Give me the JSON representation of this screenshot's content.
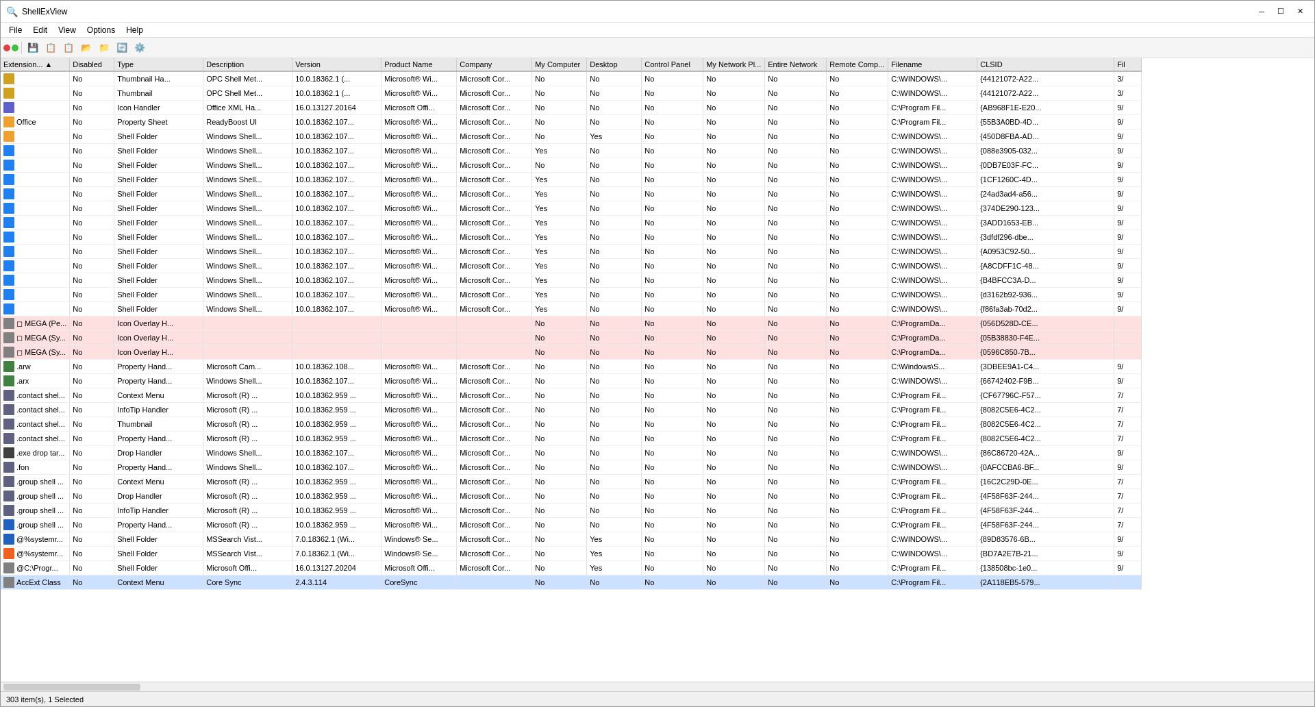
{
  "window": {
    "title": "ShellExView",
    "icon": "🔍"
  },
  "menus": [
    "File",
    "Edit",
    "View",
    "Options",
    "Help"
  ],
  "toolbar": {
    "dots": [
      "red-dot",
      "green-dot"
    ],
    "buttons": [
      "💾",
      "📋",
      "📋",
      "📂",
      "📁",
      "🔄",
      "⚙️"
    ]
  },
  "columns": [
    {
      "id": "ext",
      "label": "Extension...",
      "sort": true
    },
    {
      "id": "disabled",
      "label": "Disabled"
    },
    {
      "id": "type",
      "label": "Type"
    },
    {
      "id": "desc",
      "label": "Description"
    },
    {
      "id": "ver",
      "label": "Version"
    },
    {
      "id": "prod",
      "label": "Product Name"
    },
    {
      "id": "comp",
      "label": "Company"
    },
    {
      "id": "mycomp",
      "label": "My Computer"
    },
    {
      "id": "desktop",
      "label": "Desktop"
    },
    {
      "id": "cp",
      "label": "Control Panel"
    },
    {
      "id": "mynet",
      "label": "My Network Pl..."
    },
    {
      "id": "entnet",
      "label": "Entire Network"
    },
    {
      "id": "remcomp",
      "label": "Remote Comp..."
    },
    {
      "id": "filename",
      "label": "Filename"
    },
    {
      "id": "clsid",
      "label": "CLSID"
    },
    {
      "id": "fil",
      "label": "Fil"
    }
  ],
  "rows": [
    {
      "ext": "",
      "disabled": "No",
      "type": "Thumbnail Ha...",
      "desc": "OPC Shell Met...",
      "ver": "10.0.18362.1 (...",
      "prod": "Microsoft® Wi...",
      "comp": "Microsoft Cor...",
      "mycomp": "No",
      "desktop": "No",
      "cp": "No",
      "mynet": "No",
      "entnet": "No",
      "remcomp": "No",
      "filename": "C:\\WINDOWS\\...",
      "clsid": "{44121072-A22...",
      "fil": "3/",
      "highlight": ""
    },
    {
      "ext": "",
      "disabled": "No",
      "type": "Thumbnail",
      "desc": "OPC Shell Met...",
      "ver": "10.0.18362.1 (...",
      "prod": "Microsoft® Wi...",
      "comp": "Microsoft Cor...",
      "mycomp": "No",
      "desktop": "No",
      "cp": "No",
      "mynet": "No",
      "entnet": "No",
      "remcomp": "No",
      "filename": "C:\\WINDOWS\\...",
      "clsid": "{44121072-A22...",
      "fil": "3/",
      "highlight": ""
    },
    {
      "ext": "",
      "disabled": "No",
      "type": "Icon Handler",
      "desc": "Office XML Ha...",
      "ver": "16.0.13127.20164",
      "prod": "Microsoft Offi...",
      "comp": "Microsoft Cor...",
      "mycomp": "No",
      "desktop": "No",
      "cp": "No",
      "mynet": "No",
      "entnet": "No",
      "remcomp": "No",
      "filename": "C:\\Program Fil...",
      "clsid": "{AB968F1E-E20...",
      "fil": "9/",
      "highlight": ""
    },
    {
      "ext": "Office",
      "disabled": "No",
      "type": "Property Sheet",
      "desc": "ReadyBoost UI",
      "ver": "10.0.18362.107...",
      "prod": "Microsoft® Wi...",
      "comp": "Microsoft Cor...",
      "mycomp": "No",
      "desktop": "No",
      "cp": "No",
      "mynet": "No",
      "entnet": "No",
      "remcomp": "No",
      "filename": "C:\\Program Fil...",
      "clsid": "{55B3A0BD-4D...",
      "fil": "9/",
      "highlight": ""
    },
    {
      "ext": "",
      "disabled": "No",
      "type": "Shell Folder",
      "desc": "Windows Shell...",
      "ver": "10.0.18362.107...",
      "prod": "Microsoft® Wi...",
      "comp": "Microsoft Cor...",
      "mycomp": "No",
      "desktop": "Yes",
      "cp": "No",
      "mynet": "No",
      "entnet": "No",
      "remcomp": "No",
      "filename": "C:\\WINDOWS\\...",
      "clsid": "{450D8FBA-AD...",
      "fil": "9/",
      "highlight": ""
    },
    {
      "ext": "",
      "disabled": "No",
      "type": "Shell Folder",
      "desc": "Windows Shell...",
      "ver": "10.0.18362.107...",
      "prod": "Microsoft® Wi...",
      "comp": "Microsoft Cor...",
      "mycomp": "Yes",
      "desktop": "No",
      "cp": "No",
      "mynet": "No",
      "entnet": "No",
      "remcomp": "No",
      "filename": "C:\\WINDOWS\\...",
      "clsid": "{088e3905-032...",
      "fil": "9/",
      "highlight": ""
    },
    {
      "ext": "",
      "disabled": "No",
      "type": "Shell Folder",
      "desc": "Windows Shell...",
      "ver": "10.0.18362.107...",
      "prod": "Microsoft® Wi...",
      "comp": "Microsoft Cor...",
      "mycomp": "No",
      "desktop": "No",
      "cp": "No",
      "mynet": "No",
      "entnet": "No",
      "remcomp": "No",
      "filename": "C:\\WINDOWS\\...",
      "clsid": "{0DB7E03F-FC...",
      "fil": "9/",
      "highlight": ""
    },
    {
      "ext": "",
      "disabled": "No",
      "type": "Shell Folder",
      "desc": "Windows Shell...",
      "ver": "10.0.18362.107...",
      "prod": "Microsoft® Wi...",
      "comp": "Microsoft Cor...",
      "mycomp": "Yes",
      "desktop": "No",
      "cp": "No",
      "mynet": "No",
      "entnet": "No",
      "remcomp": "No",
      "filename": "C:\\WINDOWS\\...",
      "clsid": "{1CF1260C-4D...",
      "fil": "9/",
      "highlight": ""
    },
    {
      "ext": "",
      "disabled": "No",
      "type": "Shell Folder",
      "desc": "Windows Shell...",
      "ver": "10.0.18362.107...",
      "prod": "Microsoft® Wi...",
      "comp": "Microsoft Cor...",
      "mycomp": "Yes",
      "desktop": "No",
      "cp": "No",
      "mynet": "No",
      "entnet": "No",
      "remcomp": "No",
      "filename": "C:\\WINDOWS\\...",
      "clsid": "{24ad3ad4-a56...",
      "fil": "9/",
      "highlight": ""
    },
    {
      "ext": "",
      "disabled": "No",
      "type": "Shell Folder",
      "desc": "Windows Shell...",
      "ver": "10.0.18362.107...",
      "prod": "Microsoft® Wi...",
      "comp": "Microsoft Cor...",
      "mycomp": "Yes",
      "desktop": "No",
      "cp": "No",
      "mynet": "No",
      "entnet": "No",
      "remcomp": "No",
      "filename": "C:\\WINDOWS\\...",
      "clsid": "{374DE290-123...",
      "fil": "9/",
      "highlight": ""
    },
    {
      "ext": "",
      "disabled": "No",
      "type": "Shell Folder",
      "desc": "Windows Shell...",
      "ver": "10.0.18362.107...",
      "prod": "Microsoft® Wi...",
      "comp": "Microsoft Cor...",
      "mycomp": "Yes",
      "desktop": "No",
      "cp": "No",
      "mynet": "No",
      "entnet": "No",
      "remcomp": "No",
      "filename": "C:\\WINDOWS\\...",
      "clsid": "{3ADD1653-EB...",
      "fil": "9/",
      "highlight": ""
    },
    {
      "ext": "",
      "disabled": "No",
      "type": "Shell Folder",
      "desc": "Windows Shell...",
      "ver": "10.0.18362.107...",
      "prod": "Microsoft® Wi...",
      "comp": "Microsoft Cor...",
      "mycomp": "Yes",
      "desktop": "No",
      "cp": "No",
      "mynet": "No",
      "entnet": "No",
      "remcomp": "No",
      "filename": "C:\\WINDOWS\\...",
      "clsid": "{3dfdf296-dbe...",
      "fil": "9/",
      "highlight": ""
    },
    {
      "ext": "",
      "disabled": "No",
      "type": "Shell Folder",
      "desc": "Windows Shell...",
      "ver": "10.0.18362.107...",
      "prod": "Microsoft® Wi...",
      "comp": "Microsoft Cor...",
      "mycomp": "Yes",
      "desktop": "No",
      "cp": "No",
      "mynet": "No",
      "entnet": "No",
      "remcomp": "No",
      "filename": "C:\\WINDOWS\\...",
      "clsid": "{A0953C92-50...",
      "fil": "9/",
      "highlight": ""
    },
    {
      "ext": "",
      "disabled": "No",
      "type": "Shell Folder",
      "desc": "Windows Shell...",
      "ver": "10.0.18362.107...",
      "prod": "Microsoft® Wi...",
      "comp": "Microsoft Cor...",
      "mycomp": "Yes",
      "desktop": "No",
      "cp": "No",
      "mynet": "No",
      "entnet": "No",
      "remcomp": "No",
      "filename": "C:\\WINDOWS\\...",
      "clsid": "{A8CDFF1C-48...",
      "fil": "9/",
      "highlight": ""
    },
    {
      "ext": "",
      "disabled": "No",
      "type": "Shell Folder",
      "desc": "Windows Shell...",
      "ver": "10.0.18362.107...",
      "prod": "Microsoft® Wi...",
      "comp": "Microsoft Cor...",
      "mycomp": "Yes",
      "desktop": "No",
      "cp": "No",
      "mynet": "No",
      "entnet": "No",
      "remcomp": "No",
      "filename": "C:\\WINDOWS\\...",
      "clsid": "{B4BFCC3A-D...",
      "fil": "9/",
      "highlight": ""
    },
    {
      "ext": "",
      "disabled": "No",
      "type": "Shell Folder",
      "desc": "Windows Shell...",
      "ver": "10.0.18362.107...",
      "prod": "Microsoft® Wi...",
      "comp": "Microsoft Cor...",
      "mycomp": "Yes",
      "desktop": "No",
      "cp": "No",
      "mynet": "No",
      "entnet": "No",
      "remcomp": "No",
      "filename": "C:\\WINDOWS\\...",
      "clsid": "{d3162b92-936...",
      "fil": "9/",
      "highlight": ""
    },
    {
      "ext": "",
      "disabled": "No",
      "type": "Shell Folder",
      "desc": "Windows Shell...",
      "ver": "10.0.18362.107...",
      "prod": "Microsoft® Wi...",
      "comp": "Microsoft Cor...",
      "mycomp": "Yes",
      "desktop": "No",
      "cp": "No",
      "mynet": "No",
      "entnet": "No",
      "remcomp": "No",
      "filename": "C:\\WINDOWS\\...",
      "clsid": "{f86fa3ab-70d2...",
      "fil": "9/",
      "highlight": ""
    },
    {
      "ext": "◻ MEGA (Pe...",
      "disabled": "No",
      "type": "Icon Overlay H...",
      "desc": "",
      "ver": "",
      "prod": "",
      "comp": "",
      "mycomp": "No",
      "desktop": "No",
      "cp": "No",
      "mynet": "No",
      "entnet": "No",
      "remcomp": "No",
      "filename": "C:\\ProgramDa...",
      "clsid": "{056D528D-CE...",
      "fil": "",
      "highlight": "red"
    },
    {
      "ext": "◻ MEGA (Sy...",
      "disabled": "No",
      "type": "Icon Overlay H...",
      "desc": "",
      "ver": "",
      "prod": "",
      "comp": "",
      "mycomp": "No",
      "desktop": "No",
      "cp": "No",
      "mynet": "No",
      "entnet": "No",
      "remcomp": "No",
      "filename": "C:\\ProgramDa...",
      "clsid": "{05B38830-F4E...",
      "fil": "",
      "highlight": "red"
    },
    {
      "ext": "◻ MEGA (Sy...",
      "disabled": "No",
      "type": "Icon Overlay H...",
      "desc": "",
      "ver": "",
      "prod": "",
      "comp": "",
      "mycomp": "No",
      "desktop": "No",
      "cp": "No",
      "mynet": "No",
      "entnet": "No",
      "remcomp": "No",
      "filename": "C:\\ProgramDa...",
      "clsid": "{0596C850-7B...",
      "fil": "",
      "highlight": "red"
    },
    {
      "ext": ".arw",
      "disabled": "No",
      "type": "Property Hand...",
      "desc": "Microsoft Cam...",
      "ver": "10.0.18362.108...",
      "prod": "Microsoft® Wi...",
      "comp": "Microsoft Cor...",
      "mycomp": "No",
      "desktop": "No",
      "cp": "No",
      "mynet": "No",
      "entnet": "No",
      "remcomp": "No",
      "filename": "C:\\Windows\\S...",
      "clsid": "{3DBEE9A1-C4...",
      "fil": "9/",
      "highlight": ""
    },
    {
      "ext": ".arx",
      "disabled": "No",
      "type": "Property Hand...",
      "desc": "Windows Shell...",
      "ver": "10.0.18362.107...",
      "prod": "Microsoft® Wi...",
      "comp": "Microsoft Cor...",
      "mycomp": "No",
      "desktop": "No",
      "cp": "No",
      "mynet": "No",
      "entnet": "No",
      "remcomp": "No",
      "filename": "C:\\WINDOWS\\...",
      "clsid": "{66742402-F9B...",
      "fil": "9/",
      "highlight": ""
    },
    {
      "ext": ".contact shel...",
      "disabled": "No",
      "type": "Context Menu",
      "desc": "Microsoft (R) ...",
      "ver": "10.0.18362.959 ...",
      "prod": "Microsoft® Wi...",
      "comp": "Microsoft Cor...",
      "mycomp": "No",
      "desktop": "No",
      "cp": "No",
      "mynet": "No",
      "entnet": "No",
      "remcomp": "No",
      "filename": "C:\\Program Fil...",
      "clsid": "{CF67796C-F57...",
      "fil": "7/",
      "highlight": ""
    },
    {
      "ext": ".contact shel...",
      "disabled": "No",
      "type": "InfoTip Handler",
      "desc": "Microsoft (R) ...",
      "ver": "10.0.18362.959 ...",
      "prod": "Microsoft® Wi...",
      "comp": "Microsoft Cor...",
      "mycomp": "No",
      "desktop": "No",
      "cp": "No",
      "mynet": "No",
      "entnet": "No",
      "remcomp": "No",
      "filename": "C:\\Program Fil...",
      "clsid": "{8082C5E6-4C2...",
      "fil": "7/",
      "highlight": ""
    },
    {
      "ext": ".contact shel...",
      "disabled": "No",
      "type": "Thumbnail",
      "desc": "Microsoft (R) ...",
      "ver": "10.0.18362.959 ...",
      "prod": "Microsoft® Wi...",
      "comp": "Microsoft Cor...",
      "mycomp": "No",
      "desktop": "No",
      "cp": "No",
      "mynet": "No",
      "entnet": "No",
      "remcomp": "No",
      "filename": "C:\\Program Fil...",
      "clsid": "{8082C5E6-4C2...",
      "fil": "7/",
      "highlight": ""
    },
    {
      "ext": ".contact shel...",
      "disabled": "No",
      "type": "Property Hand...",
      "desc": "Microsoft (R) ...",
      "ver": "10.0.18362.959 ...",
      "prod": "Microsoft® Wi...",
      "comp": "Microsoft Cor...",
      "mycomp": "No",
      "desktop": "No",
      "cp": "No",
      "mynet": "No",
      "entnet": "No",
      "remcomp": "No",
      "filename": "C:\\Program Fil...",
      "clsid": "{8082C5E6-4C2...",
      "fil": "7/",
      "highlight": ""
    },
    {
      "ext": ".exe drop tar...",
      "disabled": "No",
      "type": "Drop Handler",
      "desc": "Windows Shell...",
      "ver": "10.0.18362.107...",
      "prod": "Microsoft® Wi...",
      "comp": "Microsoft Cor...",
      "mycomp": "No",
      "desktop": "No",
      "cp": "No",
      "mynet": "No",
      "entnet": "No",
      "remcomp": "No",
      "filename": "C:\\WINDOWS\\...",
      "clsid": "{86C86720-42A...",
      "fil": "9/",
      "highlight": ""
    },
    {
      "ext": ".fon",
      "disabled": "No",
      "type": "Property Hand...",
      "desc": "Windows Shell...",
      "ver": "10.0.18362.107...",
      "prod": "Microsoft® Wi...",
      "comp": "Microsoft Cor...",
      "mycomp": "No",
      "desktop": "No",
      "cp": "No",
      "mynet": "No",
      "entnet": "No",
      "remcomp": "No",
      "filename": "C:\\WINDOWS\\...",
      "clsid": "{0AFCCBA6-BF...",
      "fil": "9/",
      "highlight": ""
    },
    {
      "ext": ".group shell ...",
      "disabled": "No",
      "type": "Context Menu",
      "desc": "Microsoft (R) ...",
      "ver": "10.0.18362.959 ...",
      "prod": "Microsoft® Wi...",
      "comp": "Microsoft Cor...",
      "mycomp": "No",
      "desktop": "No",
      "cp": "No",
      "mynet": "No",
      "entnet": "No",
      "remcomp": "No",
      "filename": "C:\\Program Fil...",
      "clsid": "{16C2C29D-0E...",
      "fil": "7/",
      "highlight": ""
    },
    {
      "ext": ".group shell ...",
      "disabled": "No",
      "type": "Drop Handler",
      "desc": "Microsoft (R) ...",
      "ver": "10.0.18362.959 ...",
      "prod": "Microsoft® Wi...",
      "comp": "Microsoft Cor...",
      "mycomp": "No",
      "desktop": "No",
      "cp": "No",
      "mynet": "No",
      "entnet": "No",
      "remcomp": "No",
      "filename": "C:\\Program Fil...",
      "clsid": "{4F58F63F-244...",
      "fil": "7/",
      "highlight": ""
    },
    {
      "ext": ".group shell ...",
      "disabled": "No",
      "type": "InfoTip Handler",
      "desc": "Microsoft (R) ...",
      "ver": "10.0.18362.959 ...",
      "prod": "Microsoft® Wi...",
      "comp": "Microsoft Cor...",
      "mycomp": "No",
      "desktop": "No",
      "cp": "No",
      "mynet": "No",
      "entnet": "No",
      "remcomp": "No",
      "filename": "C:\\Program Fil...",
      "clsid": "{4F58F63F-244...",
      "fil": "7/",
      "highlight": ""
    },
    {
      "ext": ".group shell ...",
      "disabled": "No",
      "type": "Property Hand...",
      "desc": "Microsoft (R) ...",
      "ver": "10.0.18362.959 ...",
      "prod": "Microsoft® Wi...",
      "comp": "Microsoft Cor...",
      "mycomp": "No",
      "desktop": "No",
      "cp": "No",
      "mynet": "No",
      "entnet": "No",
      "remcomp": "No",
      "filename": "C:\\Program Fil...",
      "clsid": "{4F58F63F-244...",
      "fil": "7/",
      "highlight": ""
    },
    {
      "ext": "@%systemr...",
      "disabled": "No",
      "type": "Shell Folder",
      "desc": "MSSearch Vist...",
      "ver": "7.0.18362.1 (Wi...",
      "prod": "Windows® Se...",
      "comp": "Microsoft Cor...",
      "mycomp": "No",
      "desktop": "Yes",
      "cp": "No",
      "mynet": "No",
      "entnet": "No",
      "remcomp": "No",
      "filename": "C:\\WINDOWS\\...",
      "clsid": "{89D83576-6B...",
      "fil": "9/",
      "highlight": ""
    },
    {
      "ext": "@%systemr...",
      "disabled": "No",
      "type": "Shell Folder",
      "desc": "MSSearch Vist...",
      "ver": "7.0.18362.1 (Wi...",
      "prod": "Windows® Se...",
      "comp": "Microsoft Cor...",
      "mycomp": "No",
      "desktop": "Yes",
      "cp": "No",
      "mynet": "No",
      "entnet": "No",
      "remcomp": "No",
      "filename": "C:\\WINDOWS\\...",
      "clsid": "{BD7A2E7B-21...",
      "fil": "9/",
      "highlight": ""
    },
    {
      "ext": "@C:\\Progr...",
      "disabled": "No",
      "type": "Shell Folder",
      "desc": "Microsoft Offi...",
      "ver": "16.0.13127.20204",
      "prod": "Microsoft Offi...",
      "comp": "Microsoft Cor...",
      "mycomp": "No",
      "desktop": "Yes",
      "cp": "No",
      "mynet": "No",
      "entnet": "No",
      "remcomp": "No",
      "filename": "C:\\Program Fil...",
      "clsid": "{138508bc-1e0...",
      "fil": "9/",
      "highlight": ""
    },
    {
      "ext": "AccExt Class",
      "disabled": "No",
      "type": "Context Menu",
      "desc": "Core Sync",
      "ver": "2.4.3.114",
      "prod": "CoreSync",
      "comp": "",
      "mycomp": "No",
      "desktop": "No",
      "cp": "No",
      "mynet": "No",
      "entnet": "No",
      "remcomp": "No",
      "filename": "C:\\Program Fil...",
      "clsid": "{2A118EB5-579...",
      "fil": "",
      "highlight": "selected"
    }
  ],
  "statusbar": {
    "text": "303 item(s), 1 Selected"
  },
  "colors": {
    "highlight_red": "#ffe0e0",
    "highlight_selected": "#cce0ff",
    "header_bg": "#e8e8e8",
    "accent": "#0078d4"
  }
}
